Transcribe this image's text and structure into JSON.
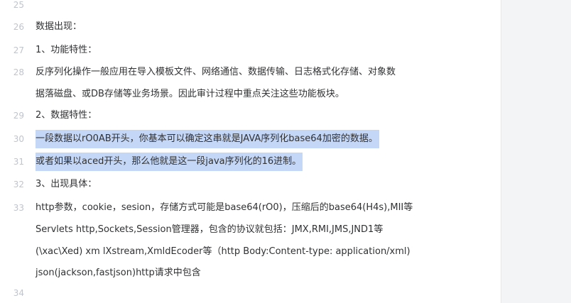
{
  "lines": [
    {
      "num": "25",
      "text": ""
    },
    {
      "num": "26",
      "text": "数据出现："
    },
    {
      "num": "27",
      "text": "1、功能特性："
    },
    {
      "num": "28",
      "text": "反序列化操作一般应用在导入模板文件、网络通信、数据传输、日志格式化存储、对象数"
    },
    {
      "num": "",
      "text": "据落磁盘、或DB存储等业务场景。因此审计过程中重点关注这些功能板块。"
    },
    {
      "num": "29",
      "text": "2、数据特性："
    },
    {
      "num": "30",
      "text": "一段数据以rO0AB开头，你基本可以确定这串就是JAVA序列化base64加密的数据。"
    },
    {
      "num": "31",
      "text": "或者如果以aced开头，那么他就是这一段java序列化的16进制。"
    },
    {
      "num": "32",
      "text": "3、出现具体："
    },
    {
      "num": "33",
      "text": "http参数，cookie，sesion，存储方式可能是base64(rO0)，压缩后的base64(H4s),MII等"
    },
    {
      "num": "",
      "text": "Servlets http,Sockets,Session管理器，包含的协议就包括：JMX,RMI,JMS,JND1等"
    },
    {
      "num": "",
      "text": "(\\xac\\Xed) xm lXstream,XmldEcoder等（http Body:Content-type: application/xml)"
    },
    {
      "num": "",
      "text": "json(jackson,fastjson)http请求中包含"
    },
    {
      "num": "",
      "text": ""
    },
    {
      "num": "34",
      "text": ""
    }
  ],
  "colors": {
    "selection": "#c4d7f7",
    "line_number": "#c0c4cc",
    "text": "#303133"
  }
}
